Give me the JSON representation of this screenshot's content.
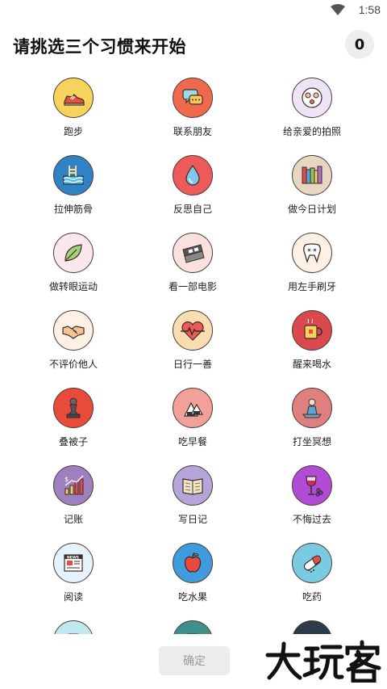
{
  "status_bar": {
    "time": "1:58",
    "icons": [
      "wifi-icon"
    ]
  },
  "header": {
    "title": "请挑选三个习惯来开始",
    "selected_count": "0"
  },
  "habits": [
    {
      "label": "跑步",
      "icon": "running-shoe-icon",
      "color": "#f7d35c"
    },
    {
      "label": "联系朋友",
      "icon": "chat-bubbles-icon",
      "color": "#ef6a4c"
    },
    {
      "label": "给亲爱的拍照",
      "icon": "face-icon",
      "color": "#efe4f6"
    },
    {
      "label": "拉伸筋骨",
      "icon": "swimming-pool-icon",
      "color": "#2f82c6"
    },
    {
      "label": "反思自己",
      "icon": "water-drop-icon",
      "color": "#ec5a5c"
    },
    {
      "label": "做今日计划",
      "icon": "books-icon",
      "color": "#e7d6c2"
    },
    {
      "label": "做转眼运动",
      "icon": "leaf-icon",
      "color": "#fbe8ec"
    },
    {
      "label": "看一部电影",
      "icon": "film-strip-icon",
      "color": "#fbe0e0"
    },
    {
      "label": "用左手刷牙",
      "icon": "tooth-icon",
      "color": "#fdf0e4"
    },
    {
      "label": "不评价他人",
      "icon": "handshake-icon",
      "color": "#fdf0e4"
    },
    {
      "label": "日行一善",
      "icon": "heartbeat-icon",
      "color": "#f9dcb0"
    },
    {
      "label": "醒来喝水",
      "icon": "mug-icon",
      "color": "#d9494e"
    },
    {
      "label": "叠被子",
      "icon": "chess-pawn-icon",
      "color": "#ea4a3a"
    },
    {
      "label": "吃早餐",
      "icon": "rice-ball-icon",
      "color": "#f2a09a"
    },
    {
      "label": "打坐冥想",
      "icon": "meditation-icon",
      "color": "#df7f7f"
    },
    {
      "label": "记账",
      "icon": "bar-chart-icon",
      "color": "#9e7fbf"
    },
    {
      "label": "写日记",
      "icon": "open-book-icon",
      "color": "#b5a5da"
    },
    {
      "label": "不悔过去",
      "icon": "wine-glass-icon",
      "color": "#b24bd3"
    },
    {
      "label": "阅读",
      "icon": "newspaper-icon",
      "color": "#e5f1fb"
    },
    {
      "label": "吃水果",
      "icon": "apple-icon",
      "color": "#3f9bdc"
    },
    {
      "label": "吃药",
      "icon": "pill-icon",
      "color": "#78cbe1"
    },
    {
      "label": "",
      "icon": "partial-icon",
      "color": "#bfe8ef"
    },
    {
      "label": "",
      "icon": "partial-icon",
      "color": "#3f8f8a"
    },
    {
      "label": "",
      "icon": "partial-icon",
      "color": "#2c3a4a"
    }
  ],
  "footer": {
    "confirm_label": "确定"
  },
  "watermark": {
    "text": "大玩客"
  }
}
